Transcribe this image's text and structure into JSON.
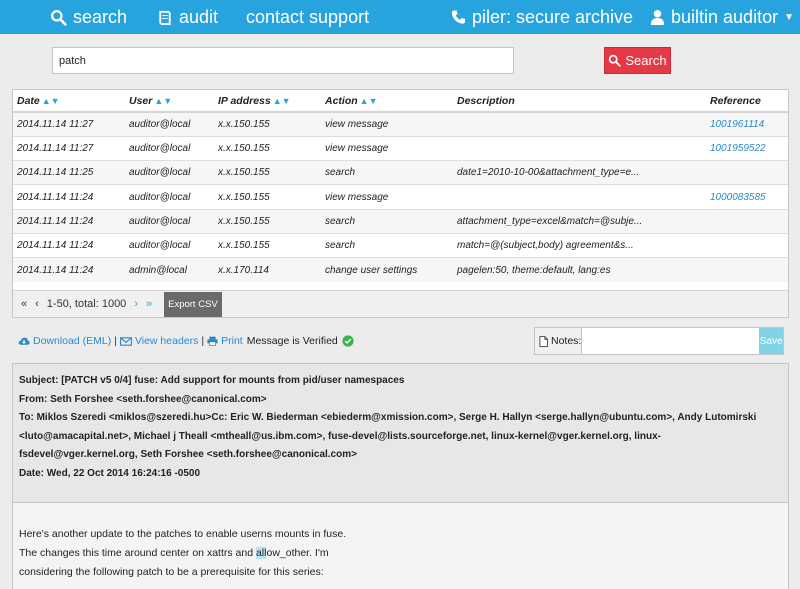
{
  "nav": {
    "search": "search",
    "audit": "audit",
    "contact": "contact support",
    "brand": "piler: secure archive",
    "user": "builtin auditor"
  },
  "search": {
    "value": "patch",
    "button": "Search"
  },
  "table": {
    "headers": [
      "Date",
      "User",
      "IP address",
      "Action",
      "Description",
      "Reference"
    ],
    "rows": [
      [
        "2014.11.14 11:27",
        "auditor@local",
        "x.x.150.155",
        "view message",
        "",
        "1001961114"
      ],
      [
        "2014.11.14 11:27",
        "auditor@local",
        "x.x.150.155",
        "view message",
        "",
        "1001959522"
      ],
      [
        "2014.11.14 11:25",
        "auditor@local",
        "x.x.150.155",
        "search",
        "date1=2010-10-00&attachment_type=e...",
        ""
      ],
      [
        "2014.11.14 11:24",
        "auditor@local",
        "x.x.150.155",
        "view message",
        "",
        "1000083585"
      ],
      [
        "2014.11.14 11:24",
        "auditor@local",
        "x.x.150.155",
        "search",
        "attachment_type=excel&match=@subje...",
        ""
      ],
      [
        "2014.11.14 11:24",
        "auditor@local",
        "x.x.150.155",
        "search",
        "match=@(subject,body) agreement&s...",
        ""
      ],
      [
        "2014.11.14 11:24",
        "admin@local",
        "x.x.170.114",
        "change user settings",
        "pagelen:50, theme:default, lang:es",
        ""
      ]
    ]
  },
  "pager": {
    "text": "1-50, total: 1000",
    "export": "Export CSV"
  },
  "toolbar": {
    "download": "Download (EML)",
    "headers": "View headers",
    "print": "Print",
    "verified": "Message is Verified",
    "notes_label": "Notes:",
    "save": "Save"
  },
  "message": {
    "subject": "Subject: [PATCH v5 0/4] fuse: Add support for mounts from pid/user namespaces",
    "from": "From: Seth Forshee <seth.forshee@canonical.com>",
    "to_line1": "To: Miklos Szeredi <miklos@szeredi.hu>Cc: Eric W. Biederman <ebiederm@xmission.com>, Serge H. Hallyn <serge.hallyn@ubuntu.com>, Andy Lutomirski",
    "to_line2": "<luto@amacapital.net>, Michael j Theall <mtheall@us.ibm.com>, fuse-devel@lists.sourceforge.net, linux-kernel@vger.kernel.org, linux-",
    "to_line3": "fsdevel@vger.kernel.org, Seth Forshee <seth.forshee@canonical.com>",
    "date": "Date: Wed, 22 Oct 2014 16:24:16 -0500",
    "body_line1": "Here's another update to the patches to enable userns mounts in fuse.",
    "body_line2_pre": "The changes this time around center on xattrs and ",
    "body_line2_hl": "all",
    "body_line2_post": "ow_other. I'm",
    "body_line3": "considering the following patch to be a prerequisite for this series:"
  },
  "colors": {
    "nav_bg": "#27a3dd",
    "search_button": "#e63946",
    "link": "#2a8ac7",
    "save_button": "#7fd3e6"
  }
}
